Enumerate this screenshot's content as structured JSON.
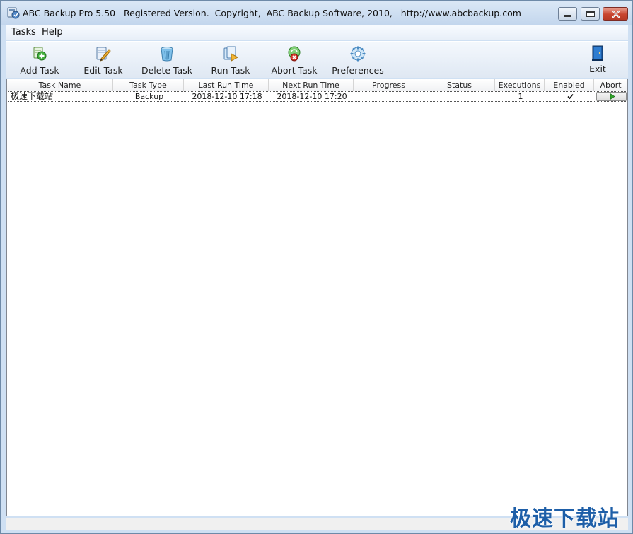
{
  "window": {
    "title": "ABC Backup Pro 5.50   Registered Version.  Copyright,  ABC Backup Software, 2010,   http://www.abcbackup.com"
  },
  "menu": {
    "items": [
      {
        "label": "Tasks"
      },
      {
        "label": "Help"
      }
    ]
  },
  "toolbar": {
    "buttons": [
      {
        "label": "Add Task",
        "icon": "add-task-icon"
      },
      {
        "label": "Edit Task",
        "icon": "edit-task-icon"
      },
      {
        "label": "Delete Task",
        "icon": "delete-task-icon"
      },
      {
        "label": "Run Task",
        "icon": "run-task-icon"
      },
      {
        "label": "Abort Task",
        "icon": "abort-task-icon"
      },
      {
        "label": "Preferences",
        "icon": "preferences-icon"
      },
      {
        "label": "Exit",
        "icon": "exit-icon"
      }
    ]
  },
  "table": {
    "columns": [
      "Task Name",
      "Task Type",
      "Last Run Time",
      "Next Run Time",
      "Progress",
      "Status",
      "Executions",
      "Enabled",
      "Abort"
    ],
    "rows": [
      {
        "task_name": "极速下载站",
        "task_type": "Backup",
        "last_run_time": "2018-12-10 17:18",
        "next_run_time": "2018-12-10 17:20",
        "progress": "",
        "status": "",
        "executions": "1",
        "enabled": true
      }
    ]
  },
  "watermark": "极速下载站",
  "colors": {
    "title_bg": "#c3d6ed",
    "close_red": "#c8452f",
    "watermark_blue": "#1e5fa8"
  }
}
